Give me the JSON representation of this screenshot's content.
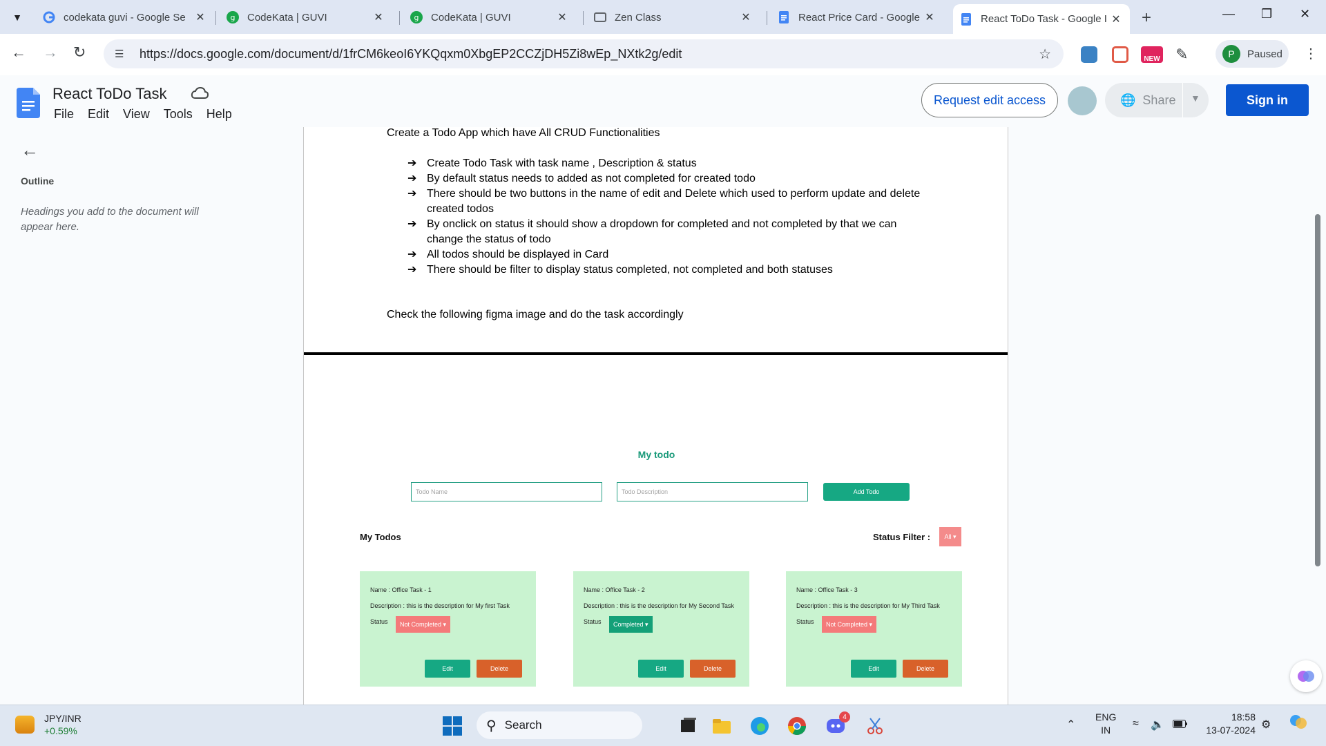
{
  "browser": {
    "tabs": [
      {
        "title": "codekata guvi - Google Se",
        "icon": "google-icon"
      },
      {
        "title": "CodeKata | GUVI",
        "icon": "guvi-icon"
      },
      {
        "title": "CodeKata | GUVI",
        "icon": "guvi-icon"
      },
      {
        "title": "Zen Class",
        "icon": "zen-class-icon"
      },
      {
        "title": "React Price Card - Google I",
        "icon": "docs-icon"
      },
      {
        "title": "React ToDo Task - Google I",
        "icon": "docs-icon",
        "active": true
      }
    ],
    "url": "https://docs.google.com/document/d/1frCM6keoI6YKQqxm0XbgEP2CCZjDH5Zi8wEp_NXtk2g/edit",
    "profile": {
      "initial": "P",
      "label": "Paused"
    },
    "new_badge": "NEW"
  },
  "docs": {
    "title": "React ToDo Task",
    "menu": [
      "File",
      "Edit",
      "View",
      "Tools",
      "Help"
    ],
    "request_edit": "Request edit access",
    "share": "Share",
    "sign_in": "Sign in",
    "brand_color": "#0b57d0"
  },
  "outline": {
    "title": "Outline",
    "hint": "Headings you add to the document will appear here."
  },
  "document": {
    "intro": "Create a Todo App which have All CRUD Functionalities",
    "bullets": [
      "Create Todo Task with task name , Description & status",
      "By default status needs to added as not completed for created todo",
      "There should be two buttons in the name of edit and Delete which used to perform update and delete created todos",
      "By onclick on status it should show a dropdown for completed and not completed by that we can change the status of todo",
      "All todos should be displayed in Card",
      "There should be filter to display status completed, not completed and both statuses"
    ],
    "outro": "Check the following figma image and do the task accordingly"
  },
  "mock": {
    "title": "My todo",
    "name_placeholder": "Todo Name",
    "desc_placeholder": "Todo Description",
    "add_label": "Add Todo",
    "list_title": "My Todos",
    "filter_label": "Status Filter  :",
    "filter_value": "All ▾",
    "cards": [
      {
        "name": "Name  :  Office Task - 1",
        "desc": "Description  :  this is the description for My first Task",
        "status_label": "Status",
        "status": "Not Completed ▾",
        "completed": false,
        "edit": "Edit",
        "delete": "Delete"
      },
      {
        "name": "Name  :  Office Task - 2",
        "desc": "Description  :  this is the description for My Second Task",
        "status_label": "Status",
        "status": "Completed ▾",
        "completed": true,
        "edit": "Edit",
        "delete": "Delete"
      },
      {
        "name": "Name  :  Office Task - 3",
        "desc": "Description  :  this is the description for My Third Task",
        "status_label": "Status",
        "status": "Not Completed ▾",
        "completed": false,
        "edit": "Edit",
        "delete": "Delete"
      }
    ]
  },
  "taskbar": {
    "stock_pair": "JPY/INR",
    "stock_change": "+0.59%",
    "search": "Search",
    "lang1": "ENG",
    "lang2": "IN",
    "time": "18:58",
    "date": "13-07-2024",
    "discord_badge": "4"
  }
}
